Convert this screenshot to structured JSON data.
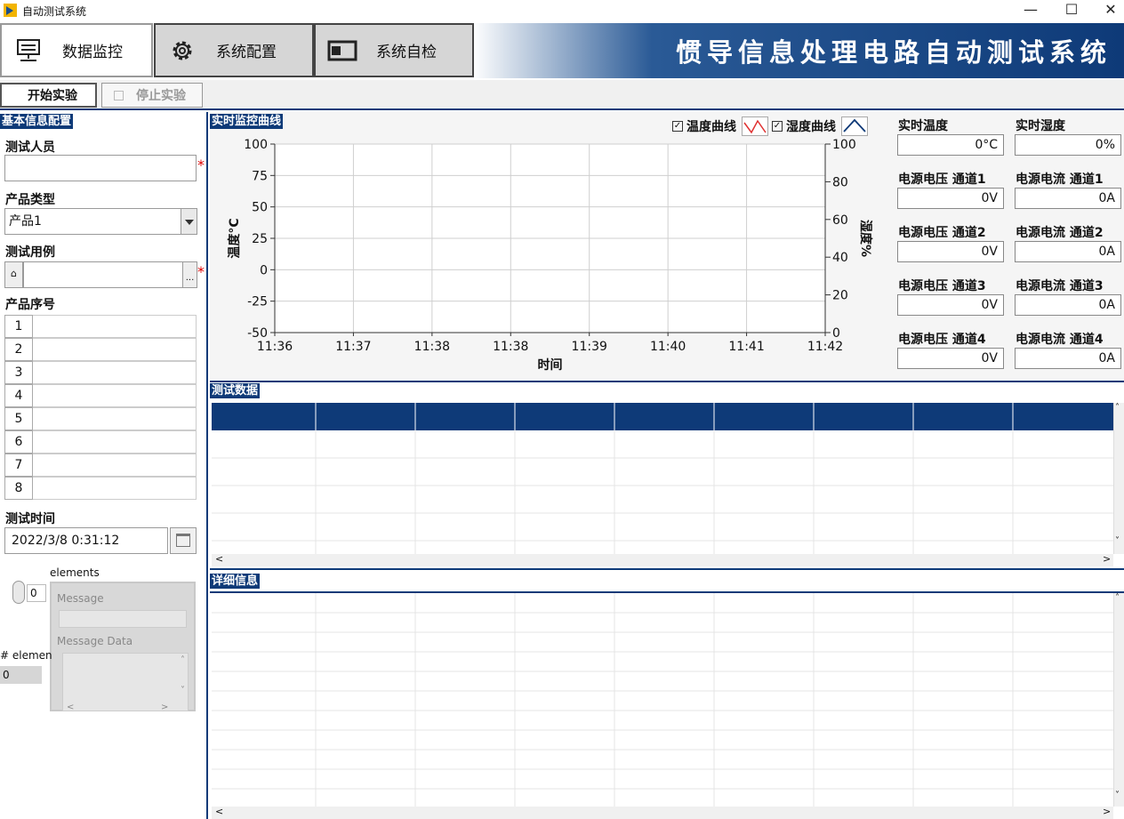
{
  "window": {
    "title": "自动测试系统",
    "minimize": "—",
    "maximize": "☐",
    "close": "✕"
  },
  "header": {
    "tabs": [
      {
        "label": "数据监控",
        "icon": "monitor-icon"
      },
      {
        "label": "系统配置",
        "icon": "gear-icon"
      },
      {
        "label": "系统自检",
        "icon": "selfcheck-icon"
      }
    ],
    "app_heading": "惯导信息处理电路自动测试系统"
  },
  "toolbar": {
    "start_label": "开始实验",
    "stop_label": "停止实验"
  },
  "left": {
    "section_title": "基本信息配置",
    "tester_label": "测试人员",
    "tester_value": "",
    "product_type_label": "产品类型",
    "product_type_value": "产品1",
    "test_case_label": "测试用例",
    "test_case_value": "",
    "browse_label": "...",
    "serial_label": "产品序号",
    "serial_indices": [
      "1",
      "2",
      "3",
      "4",
      "5",
      "6",
      "7",
      "8"
    ],
    "time_label": "测试时间",
    "time_value": "2022/3/8 0:31:12",
    "required_mark": "*",
    "cluster": {
      "elements_label": "elements",
      "index_value": "0",
      "message_label": "Message",
      "message_data_label": "Message Data",
      "count_label": "# elements",
      "count_value": "0"
    }
  },
  "chart_section_title": "实时监控曲线",
  "chart_data": {
    "type": "line",
    "title": "",
    "xlabel": "时间",
    "ylabel": "温度°C",
    "y2label": "湿度%",
    "x_ticks": [
      "11:36",
      "11:37",
      "11:38",
      "11:38",
      "11:39",
      "11:40",
      "11:41",
      "11:42"
    ],
    "y_ticks": [
      "100",
      "75",
      "50",
      "25",
      "0",
      "-25",
      "-50"
    ],
    "y2_ticks": [
      "100",
      "80",
      "60",
      "40",
      "20",
      "0"
    ],
    "ylim": [
      -50,
      100
    ],
    "y2lim": [
      0,
      100
    ],
    "grid": true,
    "series": [
      {
        "name": "温度曲线",
        "values": [],
        "color": "#e03030",
        "checked": true
      },
      {
        "name": "湿度曲线",
        "values": [],
        "color": "#0e3a78",
        "checked": true
      }
    ]
  },
  "readouts": [
    {
      "label": "实时温度",
      "value": "0°C"
    },
    {
      "label": "实时湿度",
      "value": "0%"
    },
    {
      "label": "电源电压 通道1",
      "value": "0V"
    },
    {
      "label": "电源电流 通道1",
      "value": "0A"
    },
    {
      "label": "电源电压 通道2",
      "value": "0V"
    },
    {
      "label": "电源电流 通道2",
      "value": "0A"
    },
    {
      "label": "电源电压 通道3",
      "value": "0V"
    },
    {
      "label": "电源电流 通道3",
      "value": "0A"
    },
    {
      "label": "电源电压 通道4",
      "value": "0V"
    },
    {
      "label": "电源电流 通道4",
      "value": "0A"
    }
  ],
  "test_data": {
    "title": "测试数据"
  },
  "details": {
    "title": "详细信息"
  },
  "scroll": {
    "up": "˄",
    "down": "˅",
    "left": "<",
    "right": ">"
  },
  "colors": {
    "brand": "#0e3a78",
    "chart_bg": "#ffffff",
    "grid": "#cfcfcf"
  }
}
